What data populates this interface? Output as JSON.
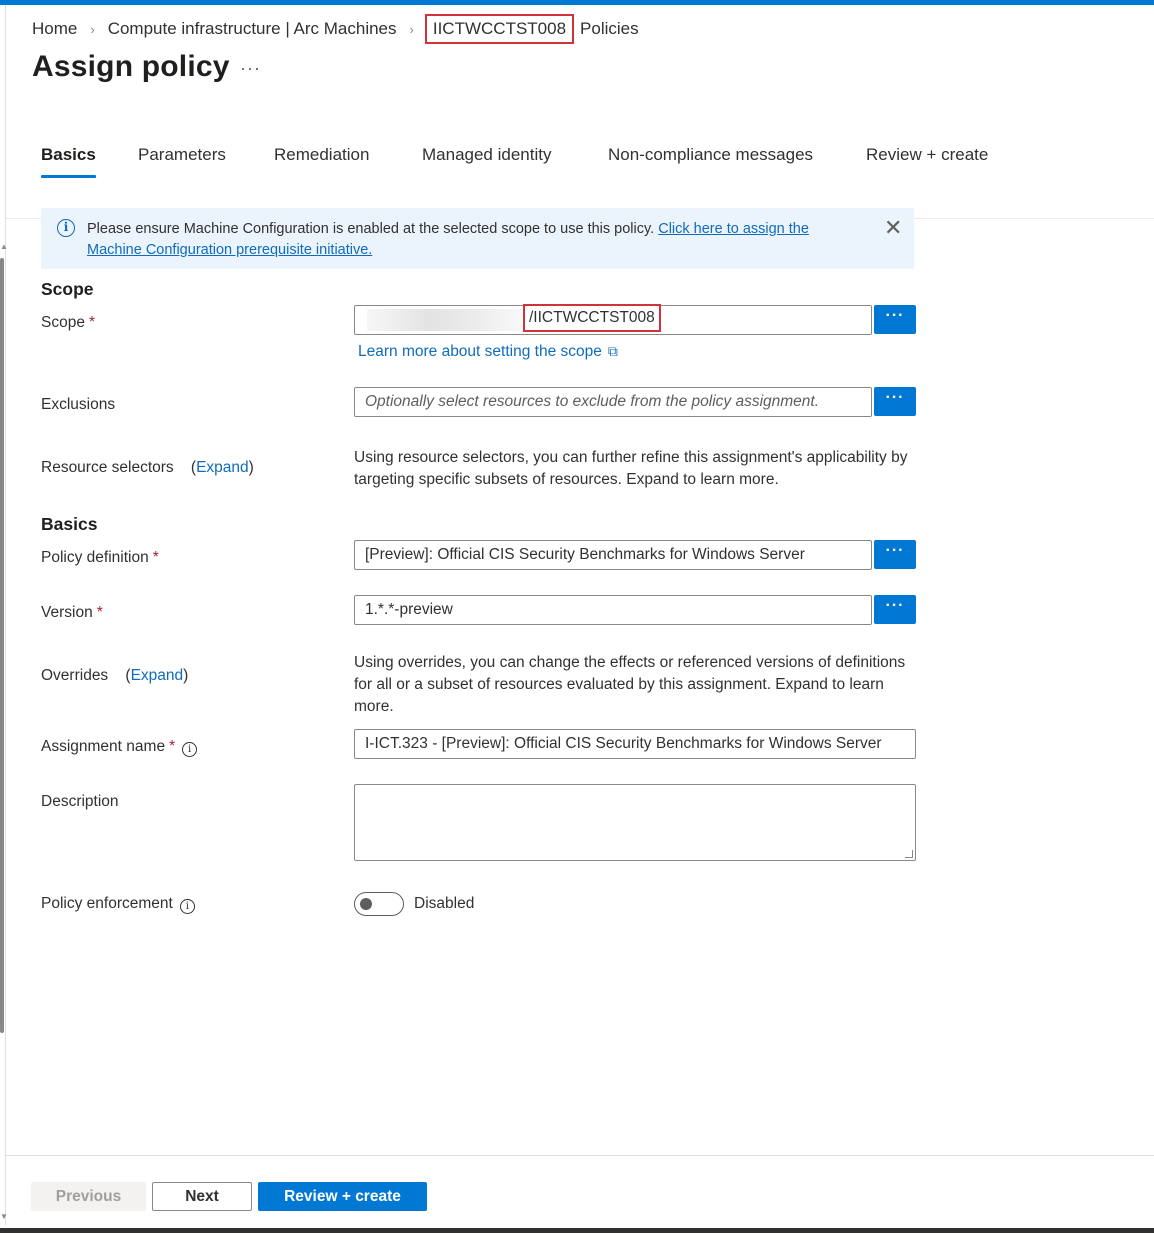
{
  "breadcrumb": {
    "home": "Home",
    "compute": "Compute infrastructure | Arc Machines",
    "machine": "IICTWCCTST008",
    "policies": "Policies"
  },
  "page": {
    "title": "Assign policy",
    "more": "···"
  },
  "tabs": [
    {
      "label": "Basics",
      "active": true
    },
    {
      "label": "Parameters"
    },
    {
      "label": "Remediation"
    },
    {
      "label": "Managed identity"
    },
    {
      "label": "Non-compliance messages"
    },
    {
      "label": "Review + create"
    }
  ],
  "info": {
    "text": "Please ensure Machine Configuration is enabled at the selected scope to use this policy. ",
    "link": "Click here to assign the Machine Configuration prerequisite initiative."
  },
  "scope_section": {
    "title": "Scope",
    "scope_label": "Scope",
    "scope_value": "/IICTWCCTST008",
    "learn_more": "Learn more about setting the scope",
    "exclusions_label": "Exclusions",
    "exclusions_placeholder": "Optionally select resources to exclude from the policy assignment.",
    "resource_selectors_label": "Resource selectors",
    "expand": "Expand",
    "resource_selectors_desc": "Using resource selectors, you can further refine this assignment's applicability by targeting specific subsets of resources. Expand to learn more."
  },
  "basics_section": {
    "title": "Basics",
    "policy_definition_label": "Policy definition",
    "policy_definition_value": "[Preview]: Official CIS Security Benchmarks for Windows Server",
    "version_label": "Version",
    "version_value": "1.*.*-preview",
    "overrides_label": "Overrides",
    "overrides_desc": "Using overrides, you can change the effects or referenced versions of definitions for all or a subset of resources evaluated by this assignment. Expand to learn more.",
    "assignment_name_label": "Assignment name",
    "assignment_name_value": "I-ICT.323 - [Preview]: Official CIS Security Benchmarks for Windows Server",
    "description_label": "Description",
    "enforcement_label": "Policy enforcement",
    "enforcement_value": "Disabled"
  },
  "footer": {
    "previous": "Previous",
    "next": "Next",
    "review_create": "Review + create"
  },
  "colors": {
    "accent": "#0078d4",
    "link": "#0f6cbd",
    "highlight": "#d13438",
    "info_bg": "#ebf3fc"
  }
}
